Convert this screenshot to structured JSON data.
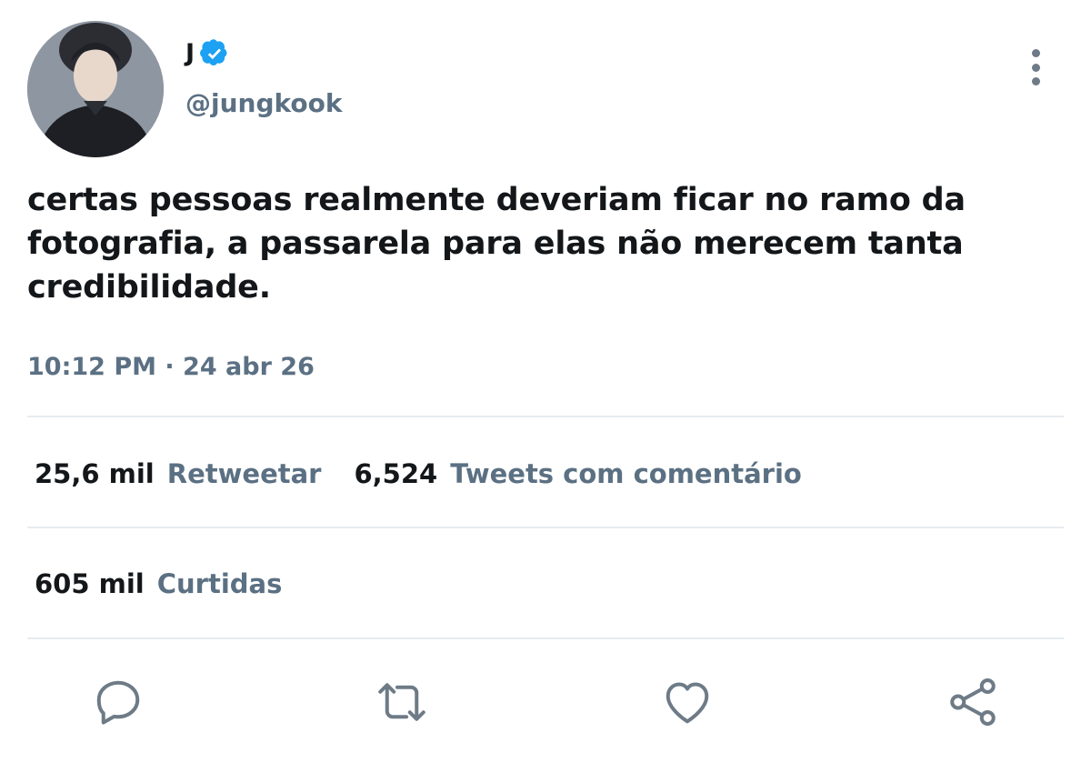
{
  "author": {
    "display_name": "J",
    "handle": "@jungkook",
    "verified": true,
    "verified_color": "#1da1f2",
    "avatar_icon": "profile-photo"
  },
  "tweet": {
    "text": "certas pessoas realmente deveriam ficar no ramo da fotografia, a passarela para elas não merecem tanta credibilidade.",
    "timestamp": "10:12 PM · 24 abr 26"
  },
  "stats": {
    "retweets_count": "25,6 mil",
    "retweets_label": "Retweetar",
    "quotes_count": "6,524",
    "quotes_label": "Tweets com comentário",
    "likes_count": "605 mil",
    "likes_label": "Curtidas"
  },
  "actions": [
    {
      "icon": "reply-icon"
    },
    {
      "icon": "retweet-icon"
    },
    {
      "icon": "like-icon"
    },
    {
      "icon": "share-icon"
    }
  ],
  "menu": {
    "icon": "more-options-icon"
  },
  "colors": {
    "text_primary": "#14171a",
    "text_secondary": "#5b7083",
    "divider": "#e6ecf0",
    "icon_gray": "#6e7b87"
  }
}
